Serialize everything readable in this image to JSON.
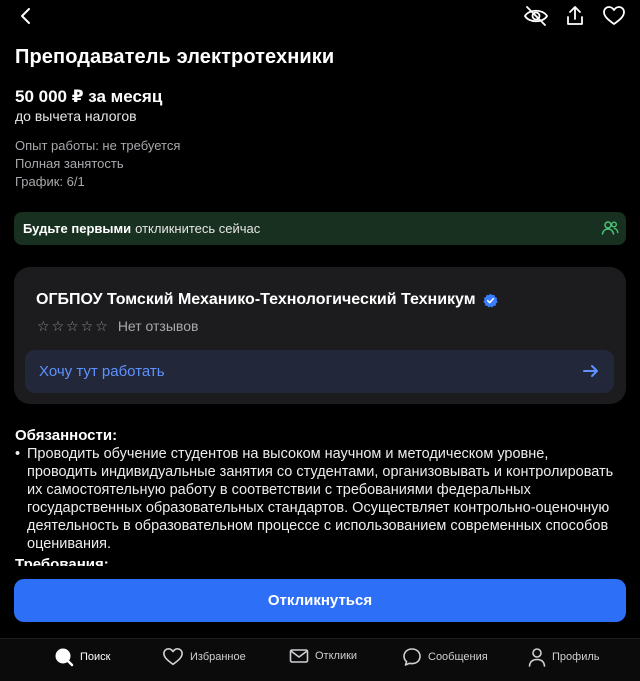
{
  "header": {
    "icons": [
      "chevron-left-icon",
      "eye-off-icon",
      "share-icon",
      "heart-icon"
    ]
  },
  "vacancy": {
    "title": "Преподаватель электротехники",
    "salary": "50 000 ₽ за месяц",
    "salary_note": "до вычета налогов",
    "experience": "Опыт работы: не требуется",
    "employment": "Полная занятость",
    "schedule": "График: 6/1"
  },
  "banner": {
    "bold": "Будьте первыми",
    "text": "откликнитесь сейчас",
    "color": "#18301f"
  },
  "employer": {
    "name": "ОГБПОУ Томский Механико-Технологический Техникум",
    "verified": true,
    "rating_stars": 0,
    "reviews_label": "Нет отзывов",
    "want_label": "Хочу тут работать"
  },
  "duties": {
    "title": "Обязанности:",
    "bullet": "•",
    "text": "Проводить обучение студентов на высоком научном и методическом уровне, проводить индивидуальные занятия со студентами, организовывать и контролировать их самостоятельную работу в соответствии с требованиями федеральных государственных образовательных стандартов. Осуществляет контрольно-оценочную деятельность в образовательном процессе с использованием современных способов оценивания."
  },
  "requirements": {
    "title": "Требования:"
  },
  "apply_button": {
    "label": "Откликнуться",
    "color": "#2d6ff6"
  },
  "tabbar": {
    "items": [
      {
        "label": "Поиск",
        "icon": "search-icon",
        "active": true
      },
      {
        "label": "Избранное",
        "icon": "heart-icon"
      },
      {
        "label": "Отклики",
        "icon": "mail-icon"
      },
      {
        "label": "Сообщения",
        "icon": "chat-icon"
      },
      {
        "label": "Профиль",
        "icon": "user-icon"
      }
    ]
  }
}
